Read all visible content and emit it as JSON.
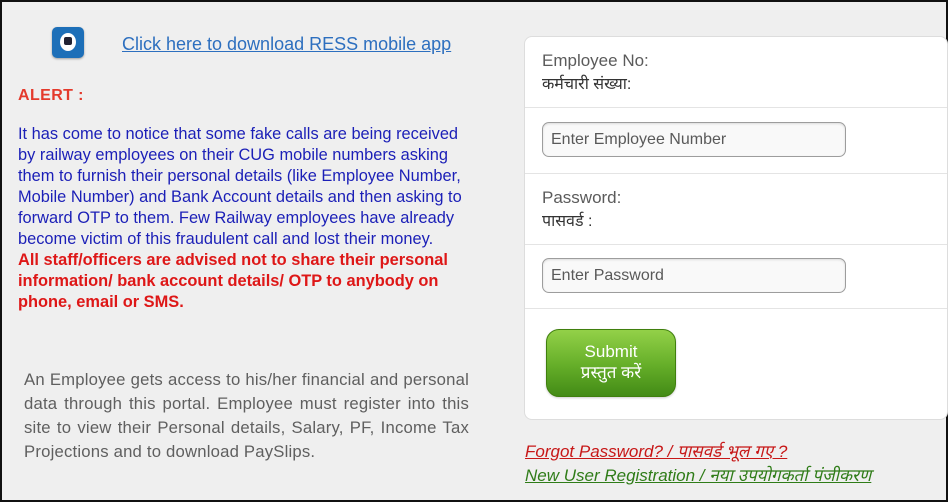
{
  "download": {
    "icon": "railway-app-icon",
    "link_text": "Click here to download RESS mobile app"
  },
  "alert": {
    "title": "ALERT :",
    "message": "It has come to notice that some fake calls are being received by railway employees on their CUG mobile numbers asking them to furnish their personal details (like Employee Number, Mobile Number) and Bank Account details and then asking to forward OTP to them. Few Railway employees have already become victim of this fraudulent call and lost their money.",
    "warning": "All staff/officers are advised not to share their personal information/ bank account details/ OTP to anybody on phone, email or SMS."
  },
  "description": "An Employee gets access to his/her financial and personal data through this portal. Employee must register into this site to view their Personal details, Salary, PF, Income Tax Projections and to download PaySlips.",
  "login": {
    "employee_label": "Employee No:",
    "employee_label_hindi": "कर्मचारी संख्या:",
    "employee_placeholder": "Enter Employee Number",
    "employee_value": "",
    "password_label": "Password:",
    "password_label_hindi": "पासवर्ड :",
    "password_placeholder": "Enter Password",
    "password_value": "",
    "submit_label": "Submit",
    "submit_label_hindi": "प्रस्तुत करें"
  },
  "links": {
    "forgot_password": "Forgot Password? / पासवर्ड भूल गए ?",
    "new_registration": "New User Registration / नया उपयोगकर्ता पंजीकरण"
  },
  "colors": {
    "alert_title": "#e43a2c",
    "alert_text": "#1b1fb7",
    "warning_text": "#de1717",
    "submit_button": "#64ad28",
    "forgot_link": "#c71717",
    "register_link": "#2f7c18"
  }
}
